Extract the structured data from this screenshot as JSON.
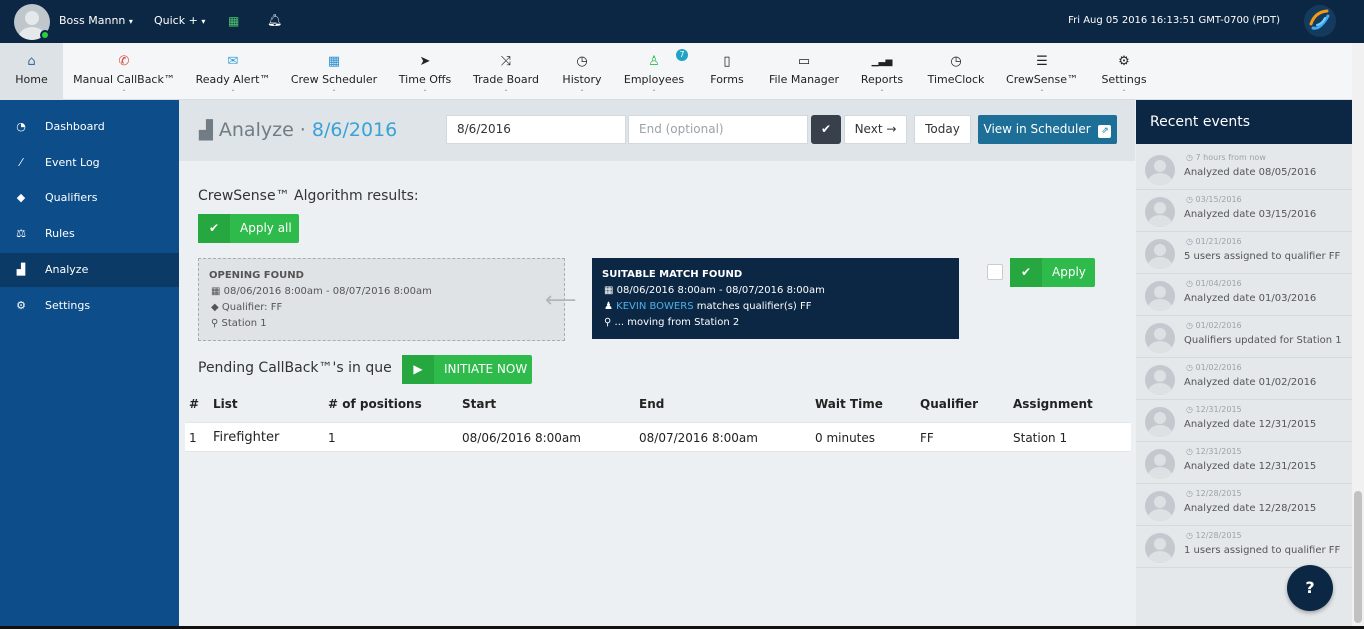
{
  "topbar": {
    "user_name": "Boss Mannn",
    "user_caret": "▾",
    "quick_label": "Quick +",
    "quick_caret": "▾",
    "datetime": "Fri Aug 05 2016 16:13:51 GMT-0700 (PDT)"
  },
  "nav": [
    {
      "label": "Home",
      "icon": "home-icon",
      "glyph": "⌂",
      "caret": ""
    },
    {
      "label": "Manual CallBack™",
      "icon": "phone-icon",
      "glyph": "✆",
      "caret": "⌄"
    },
    {
      "label": "Ready Alert™",
      "icon": "envelope-icon",
      "glyph": "✉",
      "caret": "⌄"
    },
    {
      "label": "Crew Scheduler",
      "icon": "calendar-icon",
      "glyph": "▦",
      "caret": "⌄"
    },
    {
      "label": "Time Offs",
      "icon": "paper-plane-icon",
      "glyph": "➤",
      "caret": "⌄"
    },
    {
      "label": "Trade Board",
      "icon": "shuffle-icon",
      "glyph": "⤨",
      "caret": "⌄"
    },
    {
      "label": "History",
      "icon": "clock-icon",
      "glyph": "◷",
      "caret": "⌄"
    },
    {
      "label": "Employees",
      "icon": "user-icon",
      "glyph": "♙",
      "caret": "⌄",
      "badge": "7"
    },
    {
      "label": "Forms",
      "icon": "file-icon",
      "glyph": "▯",
      "caret": ""
    },
    {
      "label": "File Manager",
      "icon": "folder-icon",
      "glyph": "▭",
      "caret": ""
    },
    {
      "label": "Reports",
      "icon": "signal-icon",
      "glyph": "▁▃▅",
      "caret": "⌄"
    },
    {
      "label": "TimeClock",
      "icon": "stopwatch-icon",
      "glyph": "◷",
      "caret": ""
    },
    {
      "label": "CrewSense™",
      "icon": "server-icon",
      "glyph": "☰",
      "caret": "⌄"
    },
    {
      "label": "Settings",
      "icon": "gears-icon",
      "glyph": "⚙",
      "caret": "⌄"
    }
  ],
  "sidebar": [
    {
      "label": "Dashboard",
      "icon": "dashboard-icon",
      "glyph": "◔"
    },
    {
      "label": "Event Log",
      "icon": "magic-wand-icon",
      "glyph": "⁄"
    },
    {
      "label": "Qualifiers",
      "icon": "tags-icon",
      "glyph": "◆"
    },
    {
      "label": "Rules",
      "icon": "balance-scale-icon",
      "glyph": "⚖"
    },
    {
      "label": "Analyze",
      "icon": "bar-chart-icon",
      "glyph": "▟"
    },
    {
      "label": "Settings",
      "icon": "gears-icon",
      "glyph": "⚙"
    }
  ],
  "header": {
    "title_prefix": "Analyze · ",
    "title_date": "8/6/2016",
    "start_date_value": "8/6/2016",
    "end_date_placeholder": "End (optional)",
    "check_glyph": "✔",
    "next_label": "Next →",
    "today_label": "Today",
    "view_scheduler_label": "View in Scheduler",
    "external_glyph": "⇗"
  },
  "algorithm": {
    "title": "CrewSense™ Algorithm results:",
    "apply_all_label": "Apply all",
    "opening": {
      "heading": "OPENING FOUND",
      "range": "08/06/2016 8:00am - 08/07/2016 8:00am",
      "qualifier": "Qualifier: FF",
      "station": "Station 1"
    },
    "arrow": "⟵",
    "match": {
      "heading": "SUITABLE MATCH FOUND",
      "range": "08/06/2016 8:00am - 08/07/2016 8:00am",
      "person_name": "KEVIN BOWERS",
      "person_suffix": " matches qualifier(s) FF",
      "moving": "... moving from Station 2"
    },
    "apply_label": "Apply"
  },
  "pending": {
    "title": "Pending CallBack™'s in que",
    "initiate_label": "INITIATE NOW",
    "headers": [
      "#",
      "List",
      "# of positions",
      "Start",
      "End",
      "Wait Time",
      "Qualifier",
      "Assignment"
    ],
    "rows": [
      [
        "1",
        "Firefighter",
        "1",
        "08/06/2016 8:00am",
        "08/07/2016 8:00am",
        "0 minutes",
        "FF",
        "Station 1"
      ]
    ]
  },
  "recent": {
    "title": "Recent events",
    "events": [
      {
        "time": "7 hours from now",
        "text": "Analyzed date 08/05/2016"
      },
      {
        "time": "03/15/2016",
        "text": "Analyzed date 03/15/2016"
      },
      {
        "time": "01/21/2016",
        "text": "5 users assigned to qualifier FF"
      },
      {
        "time": "01/04/2016",
        "text": "Analyzed date 01/03/2016"
      },
      {
        "time": "01/02/2016",
        "text": "Qualifiers updated for Station 1"
      },
      {
        "time": "01/02/2016",
        "text": "Analyzed date 01/02/2016"
      },
      {
        "time": "12/31/2015",
        "text": "Analyzed date 12/31/2015"
      },
      {
        "time": "12/31/2015",
        "text": "Analyzed date 12/31/2015"
      },
      {
        "time": "12/28/2015",
        "text": "Analyzed date 12/28/2015"
      },
      {
        "time": "12/28/2015",
        "text": "1 users assigned to qualifier FF"
      }
    ]
  },
  "colors": {
    "topbar": "#0c2744",
    "sidebar": "#0d4d8a",
    "green": "#2fbb4b",
    "link": "#39a2d6"
  }
}
